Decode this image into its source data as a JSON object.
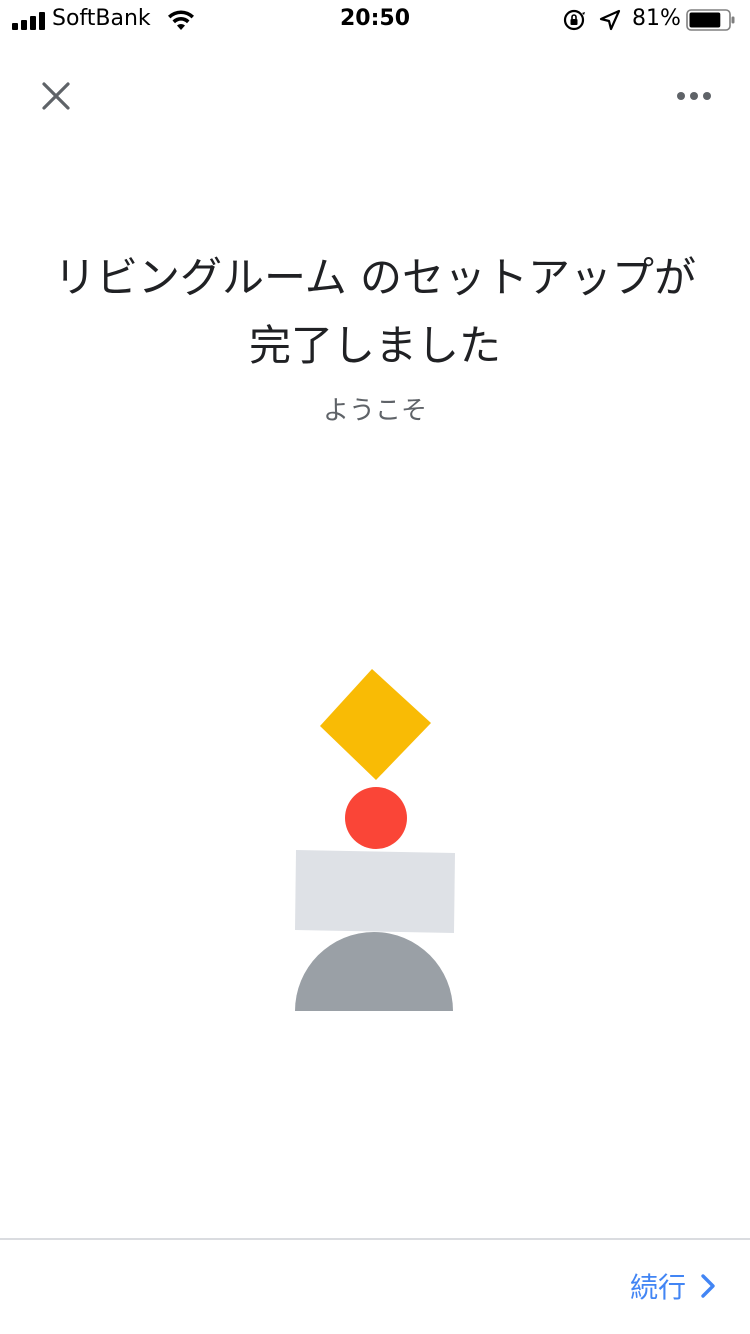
{
  "status_bar": {
    "carrier": "SoftBank",
    "time": "20:50",
    "battery_percent": "81%",
    "battery_level": 0.81,
    "icons": [
      "signal-icon",
      "wifi-icon",
      "orientation-lock-icon",
      "location-icon",
      "battery-icon"
    ]
  },
  "app_bar": {
    "close_icon": "close-icon",
    "more_icon": "more-options-icon"
  },
  "content": {
    "title": "リビングルーム のセットアップが完了しました",
    "subtitle": "ようこそ"
  },
  "illustration": {
    "shapes": [
      "yellow-diamond",
      "red-circle",
      "gray-rectangle",
      "gray-semicircle"
    ],
    "colors": {
      "diamond": "#F9BB05",
      "circle": "#FA4537",
      "rectangle": "#DEE1E6",
      "semicircle": "#9AA0A6"
    }
  },
  "footer": {
    "continue_label": "続行",
    "accent_color": "#4285F4"
  }
}
